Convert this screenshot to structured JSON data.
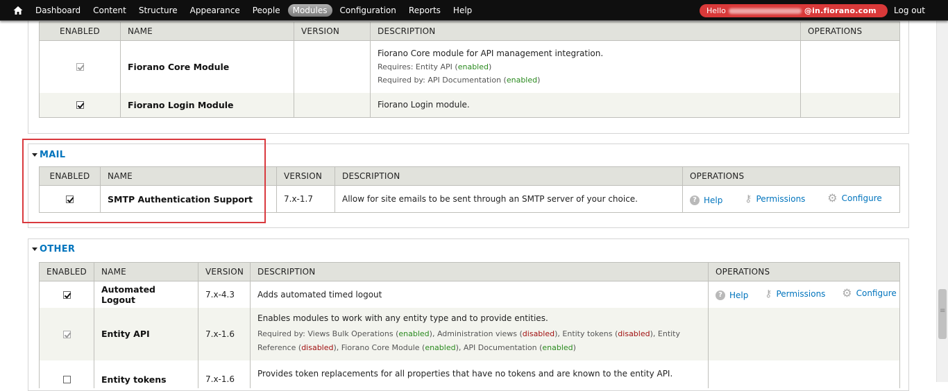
{
  "toolbar": {
    "menu": [
      "Dashboard",
      "Content",
      "Structure",
      "Appearance",
      "People",
      "Modules",
      "Configuration",
      "Reports",
      "Help"
    ],
    "active": "Modules",
    "hello": "Hello",
    "email_domain": "@in.fiorano.com",
    "logout": "Log out"
  },
  "columns": {
    "enabled": "ENABLED",
    "name": "NAME",
    "version": "VERSION",
    "description": "DESCRIPTION",
    "operations": "OPERATIONS"
  },
  "fiorano": {
    "rows": [
      {
        "name": "Fiorano Core Module",
        "description": "Fiorano Core module for API management integration.",
        "requires_prefix": "Requires: Entity API (",
        "requires_status": "enabled",
        "required_by_prefix": "Required by: API Documentation (",
        "required_by_status": "enabled"
      },
      {
        "name": "Fiorano Login Module",
        "description": "Fiorano Login module."
      }
    ]
  },
  "mail": {
    "legend": "MAIL",
    "rows": [
      {
        "name": "SMTP Authentication Support",
        "version": "7.x-1.7",
        "description": "Allow for site emails to be sent through an SMTP server of your choice.",
        "ops": [
          "Help",
          "Permissions",
          "Configure"
        ]
      }
    ]
  },
  "other": {
    "legend": "OTHER",
    "rows": [
      {
        "name": "Automated Logout",
        "version": "7.x-4.3",
        "description": "Adds automated timed logout",
        "ops": [
          "Help",
          "Permissions",
          "Configure"
        ]
      },
      {
        "name": "Entity API",
        "version": "7.x-1.6",
        "description": "Enables modules to work with any entity type and to provide entities.",
        "req": {
          "prefix": "Required by: Views Bulk Operations (",
          "s1": "enabled",
          "t2": "), Administration views (",
          "s2": "disabled",
          "t3": "), Entity tokens (",
          "s3": "disabled",
          "t4": "), Entity Reference (",
          "s4": "disabled",
          "t5": "), Fiorano Core Module (",
          "s5": "enabled",
          "t6": "), API Documentation (",
          "s6": "enabled",
          "t7": ")"
        }
      },
      {
        "name": "Entity tokens",
        "version": "7.x-1.6",
        "description": "Provides token replacements for all properties that have no tokens and are known to the entity API."
      }
    ]
  },
  "colors": {
    "accent": "#0074bd",
    "highlight": "#d9393e",
    "enabled": "#2a8a1e",
    "disabled": "#a01010"
  }
}
